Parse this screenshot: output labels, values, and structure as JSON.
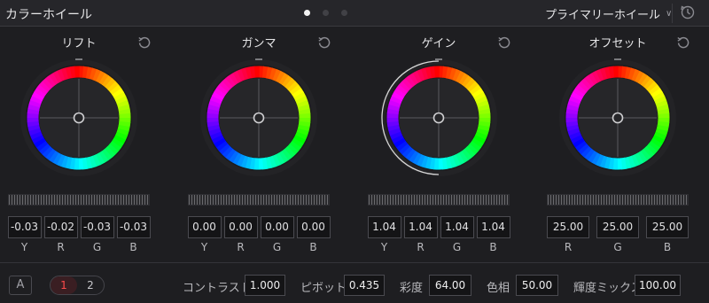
{
  "header": {
    "title": "カラーホイール",
    "page_count": 3,
    "active_page": 1,
    "mode_label": "プライマリーホイール",
    "icons": {
      "mode_dropdown": "chevron-down-icon",
      "reset_all": "reset-all-icon"
    }
  },
  "wheels": [
    {
      "name": "リフト",
      "channels": [
        "Y",
        "R",
        "G",
        "B"
      ],
      "values": [
        "-0.03",
        "-0.02",
        "-0.03",
        "-0.03"
      ],
      "highlighted": false
    },
    {
      "name": "ガンマ",
      "channels": [
        "Y",
        "R",
        "G",
        "B"
      ],
      "values": [
        "0.00",
        "0.00",
        "0.00",
        "0.00"
      ],
      "highlighted": false
    },
    {
      "name": "ゲイン",
      "channels": [
        "Y",
        "R",
        "G",
        "B"
      ],
      "values": [
        "1.04",
        "1.04",
        "1.04",
        "1.04"
      ],
      "highlighted": true
    },
    {
      "name": "オフセット",
      "channels": [
        "R",
        "G",
        "B"
      ],
      "values": [
        "25.00",
        "25.00",
        "25.00"
      ],
      "highlighted": false
    }
  ],
  "footer": {
    "a_button": "A",
    "pages": [
      "1",
      "2"
    ],
    "active_page": "1",
    "params": [
      {
        "label": "コントラスト",
        "value": "1.000"
      },
      {
        "label": "ピボット",
        "value": "0.435"
      },
      {
        "label": "彩度",
        "value": "64.00"
      },
      {
        "label": "色相",
        "value": "50.00"
      },
      {
        "label": "輝度ミックス",
        "value": "100.00"
      }
    ]
  },
  "colors": {
    "accent": "#ff4a4a",
    "panel": "#1e1e21",
    "field": "#141416"
  }
}
